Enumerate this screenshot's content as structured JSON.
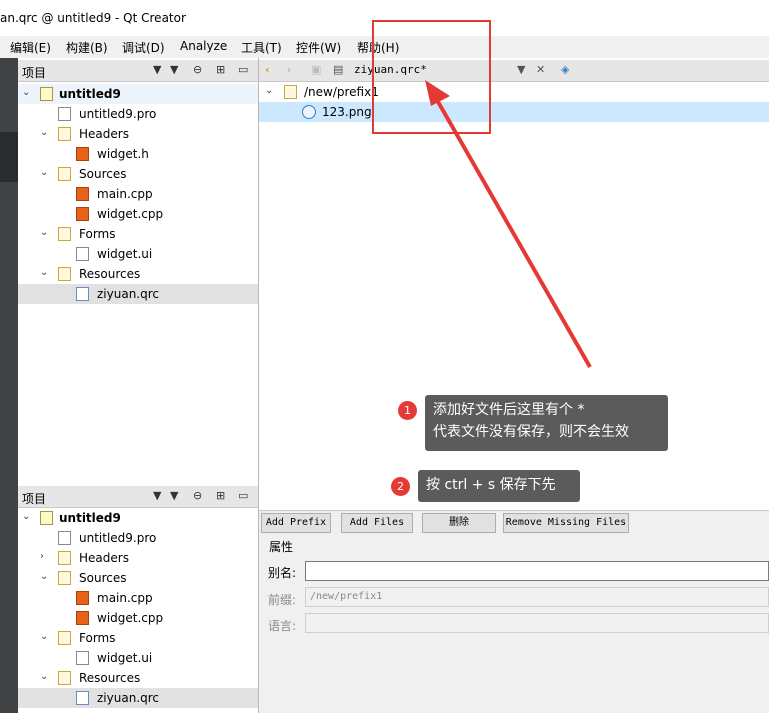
{
  "window": {
    "title": "an.qrc @ untitled9 - Qt Creator"
  },
  "menu": [
    "编辑(E)",
    "构建(B)",
    "调试(D)",
    "Analyze",
    "工具(T)",
    "控件(W)",
    "帮助(H)"
  ],
  "project_panel": {
    "label": "项目",
    "root": "untitled9",
    "pro_file": "untitled9.pro",
    "headers": "Headers",
    "widget_h": "widget.h",
    "sources": "Sources",
    "main_cpp": "main.cpp",
    "widget_cpp": "widget.cpp",
    "forms": "Forms",
    "widget_ui": "widget.ui",
    "resources": "Resources",
    "qrc": "ziyuan.qrc"
  },
  "editor": {
    "filename": "ziyuan.qrc*",
    "prefix": "/new/prefix1",
    "file": "123.png",
    "buttons": [
      "Add Prefix",
      "Add Files",
      "删除",
      "Remove Missing Files"
    ],
    "props_title": "属性",
    "alias_label": "别名:",
    "prefix_label": "前缀:",
    "prefix_value": "/new/prefix1",
    "lang_label": "语言:"
  },
  "annotations": {
    "callout1": "添加好文件后这里有个 *\n代表文件没有保存，则不会生效",
    "callout1_line1": "添加好文件后这里有个 *",
    "callout1_line2": "代表文件没有保存，则不会生效",
    "callout2": "按 ctrl + s 保存下先",
    "badge1": "1",
    "badge2": "2",
    "highlight_color": "#e53935"
  }
}
